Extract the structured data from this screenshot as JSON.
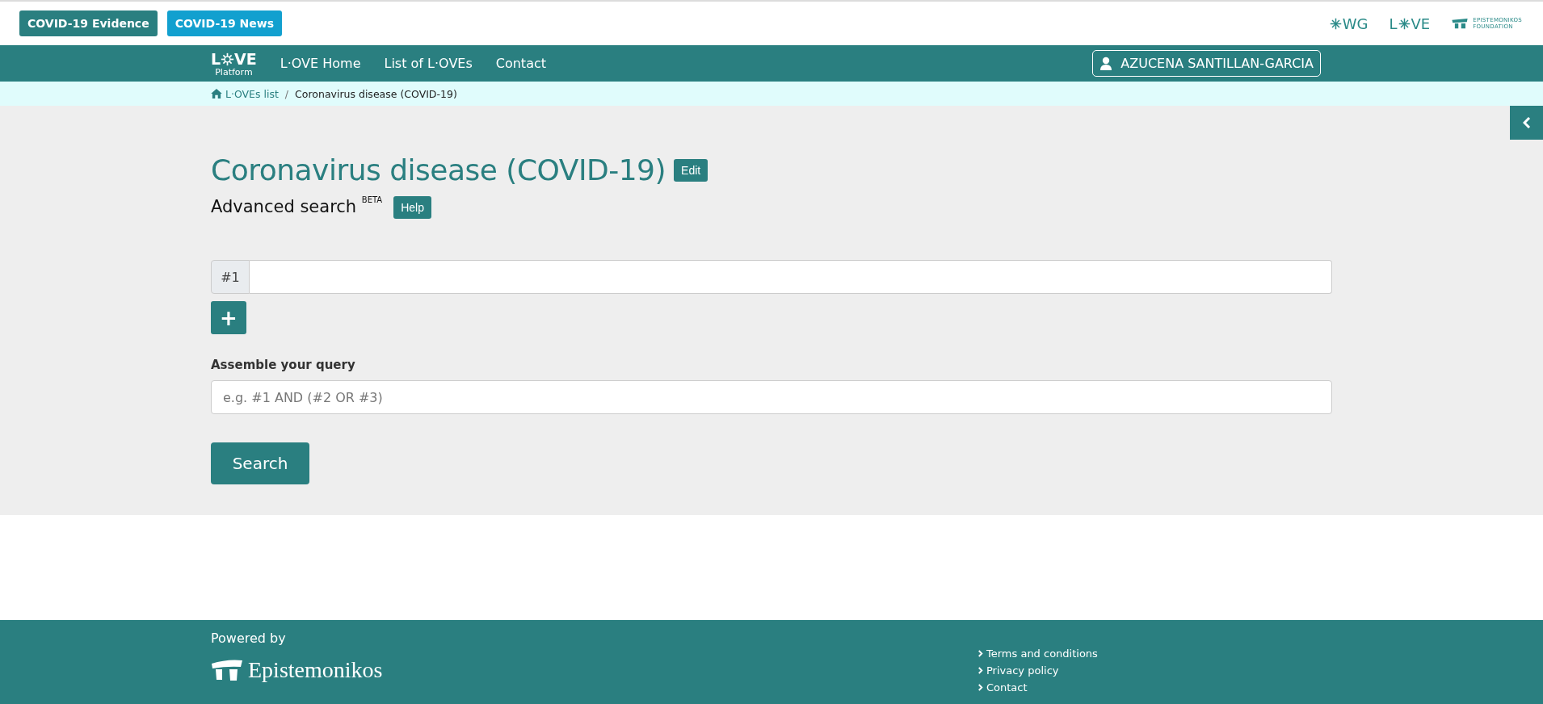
{
  "top_buttons": [
    {
      "label": "COVID-19 Evidence",
      "kind": "evidence"
    },
    {
      "label": "COVID-19 News",
      "kind": "news"
    }
  ],
  "partner_logos": {
    "wg": "WG",
    "love_left": "L",
    "love_right": "VE",
    "foundation_line1": "EPISTEMONIKOS",
    "foundation_line2": "FOUNDATION"
  },
  "nav": {
    "logo_left": "L",
    "logo_right": "VE",
    "logo_sub": "Platform",
    "links": [
      "L·OVE Home",
      "List of L·OVEs",
      "Contact"
    ],
    "user": "AZUCENA SANTILLAN-GARCIA"
  },
  "breadcrumb_separator": "/",
  "breadcrumb": [
    {
      "label": "L·OVEs list",
      "kind": "link"
    },
    {
      "label": "Coronavirus disease (COVID-19)",
      "kind": "current"
    }
  ],
  "title": "Coronavirus disease (COVID-19)",
  "edit_button": "Edit",
  "subtitle": "Advanced search $^{BETA}$",
  "help_button": "Help",
  "query_rows": [
    {
      "index": "#1"
    }
  ],
  "add_button": "+",
  "assemble_label": "Assemble your query",
  "assemble_placeholder": "e.g. #1 AND (#2 OR #3)",
  "search_button": "Search",
  "footer": {
    "powered_by": "Powered by",
    "brand": "Epistemonikos",
    "links": [
      "Terms and conditions",
      "Privacy policy",
      "Contact"
    ]
  }
}
